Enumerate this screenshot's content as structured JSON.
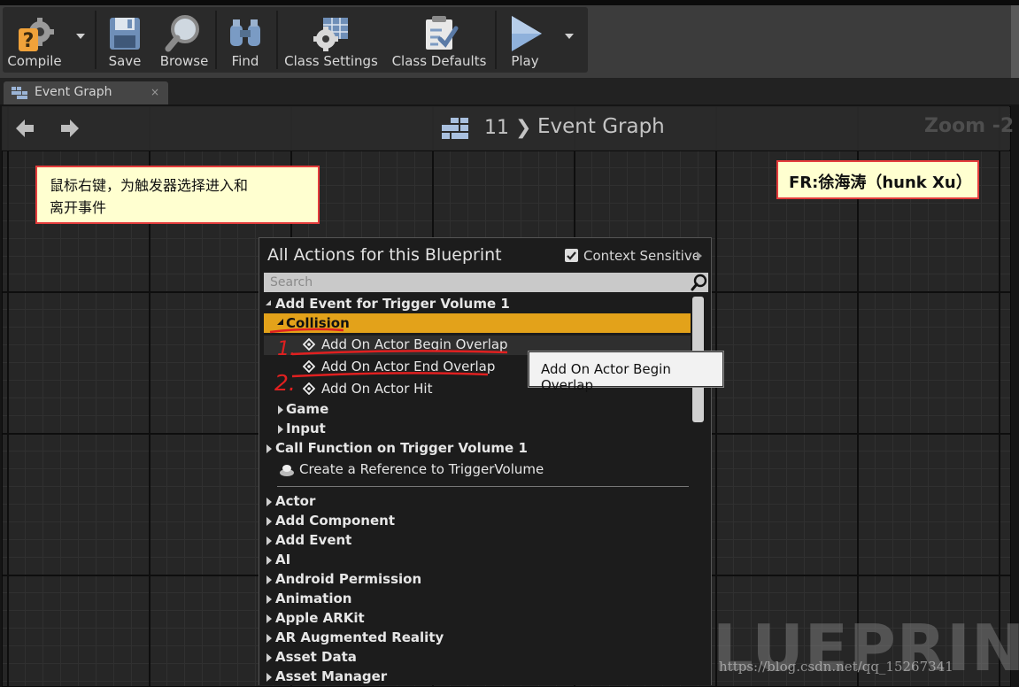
{
  "toolbar": {
    "compile": "Compile",
    "save": "Save",
    "browse": "Browse",
    "find": "Find",
    "class_settings": "Class Settings",
    "class_defaults": "Class Defaults",
    "play": "Play"
  },
  "tab": {
    "label": "Event Graph",
    "close": "×"
  },
  "graph": {
    "breadcrumb_number": "11",
    "breadcrumb_separator": "❯",
    "breadcrumb_title": "Event Graph",
    "zoom": "Zoom -2"
  },
  "notes": {
    "instruction_line1": "鼠标右键，为触发器选择进入和",
    "instruction_line2": "离开事件",
    "credit": "FR:徐海涛（hunk Xu）"
  },
  "menu": {
    "title": "All Actions for this Blueprint",
    "context_sensitive_label": "Context Sensitive",
    "context_sensitive_checked": true,
    "search_placeholder": "Search",
    "items": [
      {
        "label": "Add Event for Trigger Volume 1",
        "bold": true,
        "state": "expanded"
      },
      {
        "label": "Collision",
        "bold": true,
        "state": "expanded",
        "selected": true
      },
      {
        "label": "Add On Actor Begin Overlap",
        "bold": false,
        "icon": "event-diamond-icon"
      },
      {
        "label": "Add On Actor End Overlap",
        "bold": false,
        "icon": "event-diamond-icon"
      },
      {
        "label": "Add On Actor Hit",
        "bold": false,
        "icon": "event-diamond-icon"
      },
      {
        "label": "Game",
        "bold": true,
        "state": "collapsed"
      },
      {
        "label": "Input",
        "bold": true,
        "state": "collapsed"
      },
      {
        "label": "Call Function on Trigger Volume 1",
        "bold": true,
        "state": "collapsed"
      },
      {
        "label": "Create a Reference to TriggerVolume",
        "bold": false,
        "icon": "reference-icon"
      },
      {
        "label": "Actor",
        "bold": true,
        "state": "collapsed"
      },
      {
        "label": "Add Component",
        "bold": true,
        "state": "collapsed"
      },
      {
        "label": "Add Event",
        "bold": true,
        "state": "collapsed"
      },
      {
        "label": "AI",
        "bold": true,
        "state": "collapsed"
      },
      {
        "label": "Android Permission",
        "bold": true,
        "state": "collapsed"
      },
      {
        "label": "Animation",
        "bold": true,
        "state": "collapsed"
      },
      {
        "label": "Apple ARKit",
        "bold": true,
        "state": "collapsed"
      },
      {
        "label": "AR Augmented Reality",
        "bold": true,
        "state": "collapsed"
      },
      {
        "label": "Asset Data",
        "bold": true,
        "state": "collapsed"
      },
      {
        "label": "Asset Manager",
        "bold": true,
        "state": "collapsed"
      }
    ]
  },
  "tooltip": "Add On Actor Begin Overlap",
  "annotations": {
    "mark_1": "1.",
    "mark_2": "2."
  },
  "watermark": {
    "big": "LUEPRINT",
    "url": "https://blog.csdn.net/qq_15267341"
  },
  "colors": {
    "selection": "#e3a21a",
    "note_background": "#ffffd0",
    "note_border": "#e43c3c",
    "annotation_red": "#e02020"
  }
}
